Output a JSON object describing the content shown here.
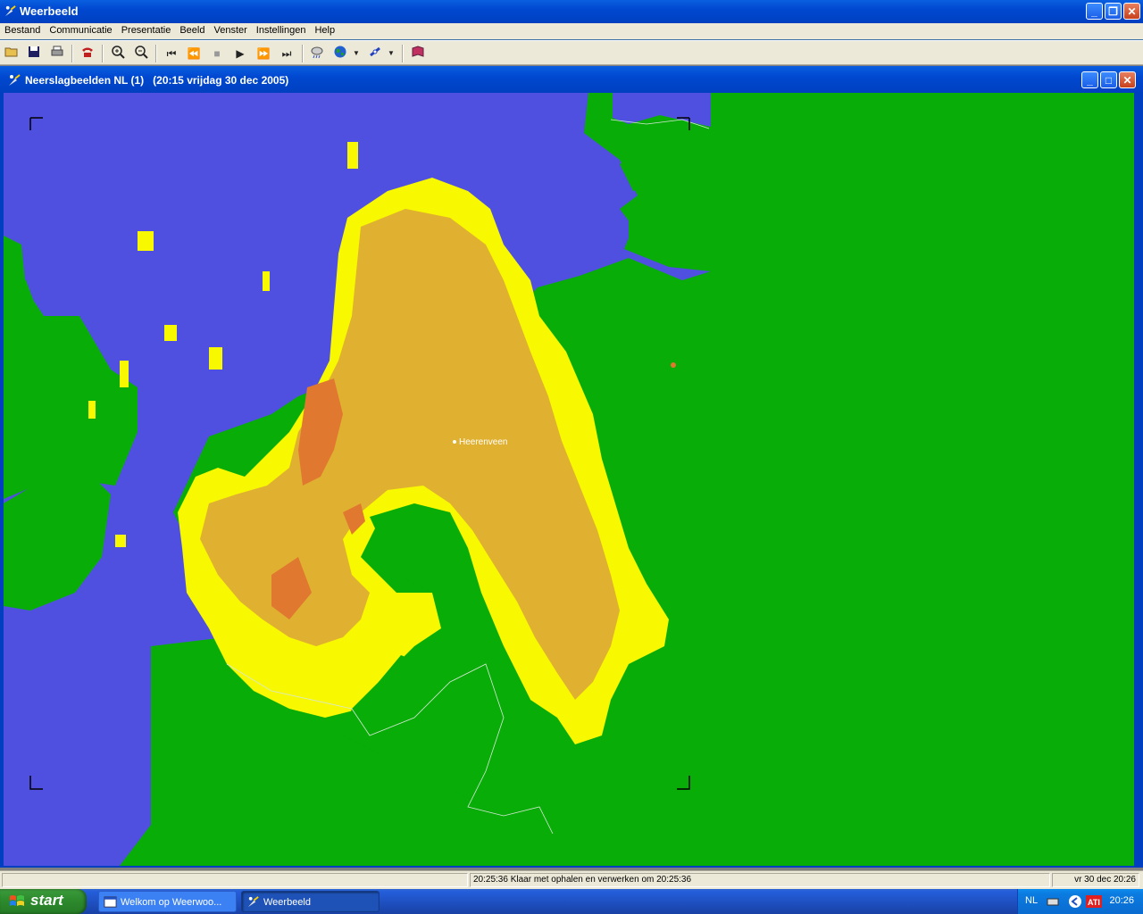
{
  "app": {
    "title": "Weerbeeld"
  },
  "menu": [
    "Bestand",
    "Communicatie",
    "Presentatie",
    "Beeld",
    "Venster",
    "Instellingen",
    "Help"
  ],
  "child_window": {
    "title": "Neerslagbeelden NL (1)",
    "timestamp": "(20:15 vrijdag 30 dec 2005)"
  },
  "map": {
    "city_label": "Heerenveen",
    "colors": {
      "water": "#5050e0",
      "land": "#08ad08",
      "rain_light": "#f8f800",
      "rain_moderate": "#e0b030",
      "rain_heavy": "#e07830"
    }
  },
  "statusbar": {
    "message": "20:25:36 Klaar met ophalen en verwerken om 20:25:36",
    "datetime": "vr 30 dec 20:26"
  },
  "taskbar": {
    "start_label": "start",
    "tasks": [
      {
        "label": "Welkom op Weerwoo..."
      },
      {
        "label": "Weerbeeld"
      }
    ],
    "tray": {
      "language": "NL",
      "clock": "20:26"
    }
  }
}
